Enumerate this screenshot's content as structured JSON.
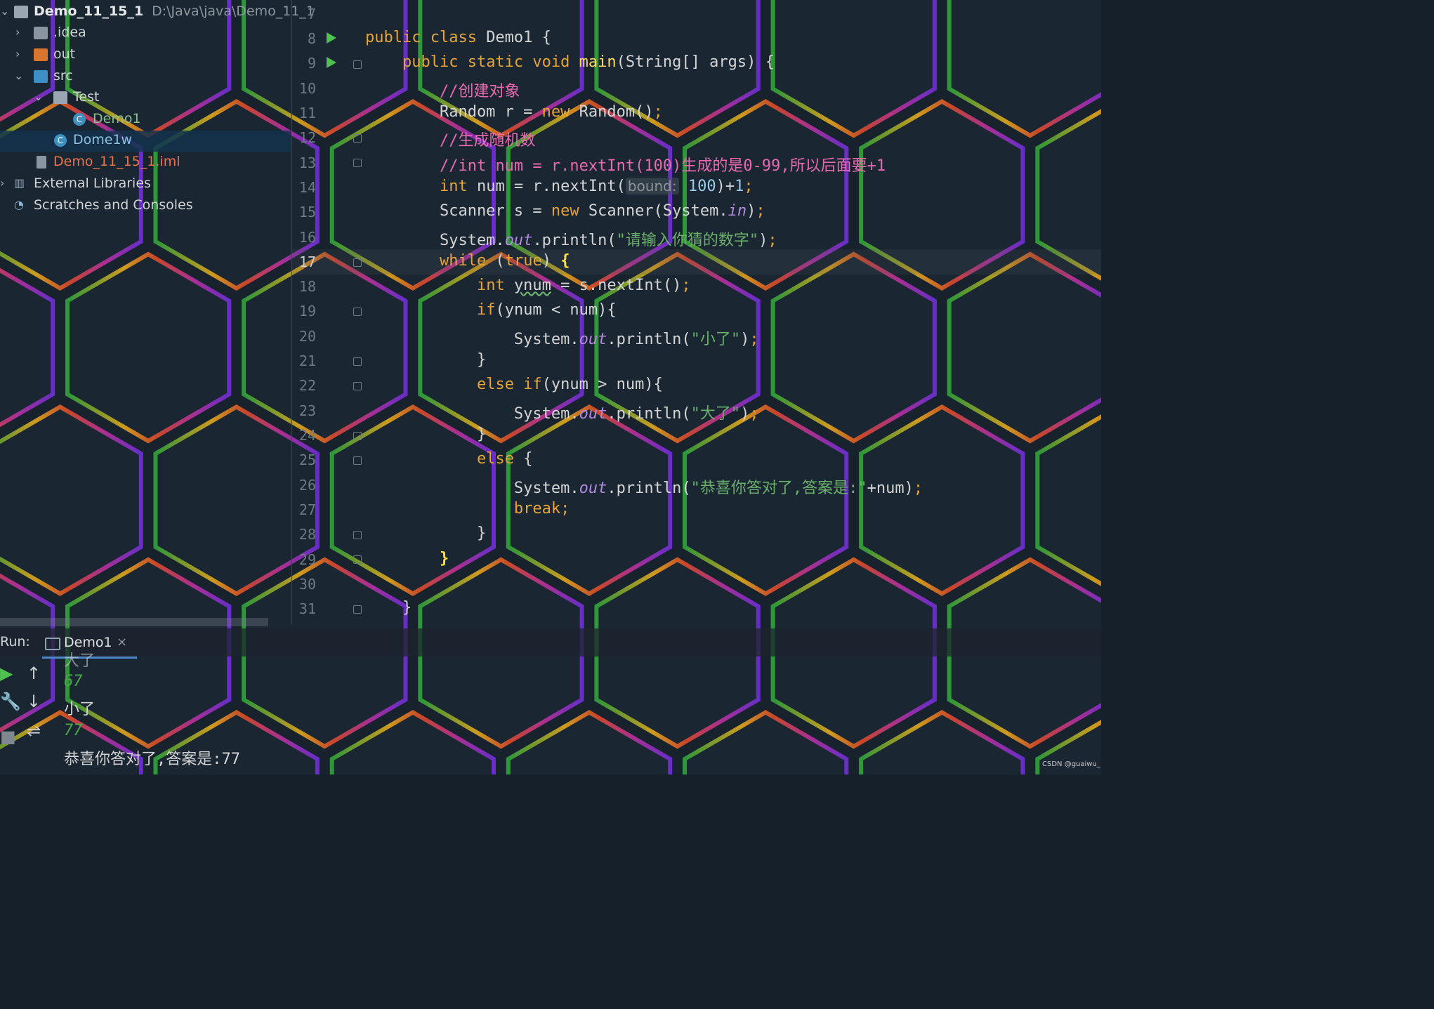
{
  "project_tree": {
    "root": {
      "name": "Demo_11_15_1",
      "path": "D:\\Java\\java\\Demo_11_1"
    },
    "items": [
      {
        "label": ".idea"
      },
      {
        "label": "out"
      },
      {
        "label": "src"
      },
      {
        "label": "Test"
      },
      {
        "label": "Demo1"
      },
      {
        "label": "Dome1w"
      },
      {
        "label": "Demo_11_15_1.iml"
      },
      {
        "label": "External Libraries"
      },
      {
        "label": "Scratches and Consoles"
      }
    ]
  },
  "editor": {
    "line_numbers": [
      "7",
      "8",
      "9",
      "10",
      "11",
      "12",
      "13",
      "14",
      "15",
      "16",
      "17",
      "18",
      "19",
      "20",
      "21",
      "22",
      "23",
      "24",
      "25",
      "26",
      "27",
      "28",
      "29",
      "30",
      "31"
    ],
    "current_line": "17",
    "param_hint": "bound:"
  },
  "run_panel": {
    "label": "Run:",
    "tab": "Demo1",
    "close": "×",
    "console_lines": [
      "大了",
      "67",
      "小了",
      "77",
      "恭喜你答对了,答案是:77"
    ]
  },
  "watermark": "CSDN @guaiwu_",
  "colors": {
    "keyword": "#e6a437",
    "comment": "#e86ab0",
    "string": "#6ab06a",
    "accent": "#4a88c7"
  },
  "icons": [
    "folder-icon",
    "class-icon",
    "run-icon",
    "wrench-icon",
    "up-arrow-icon",
    "down-arrow-icon",
    "wrap-icon",
    "stop-icon"
  ]
}
